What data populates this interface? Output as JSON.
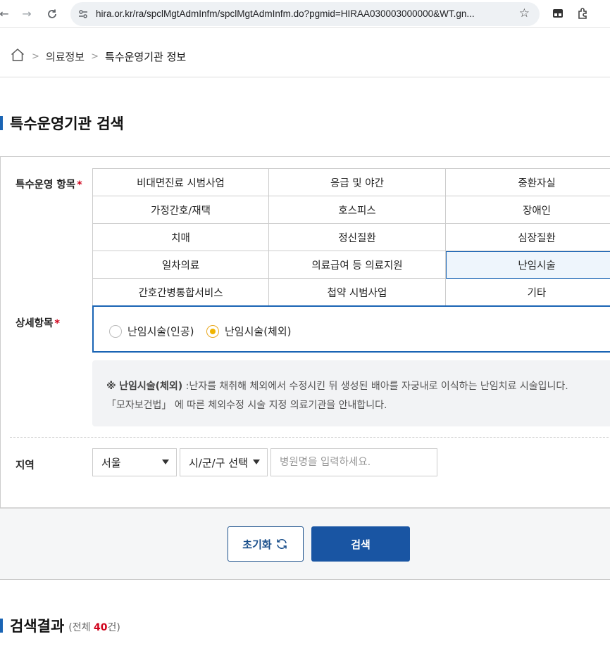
{
  "browser": {
    "url": "hira.or.kr/ra/spclMgtAdmInfm/spclMgtAdmInfm.do?pgmid=HIRAA030003000000&WT.gn..."
  },
  "breadcrumb": {
    "items": [
      "의료정보",
      "특수운영기관 정보"
    ]
  },
  "search_section": {
    "title": "특수운영기관 검색"
  },
  "form": {
    "category_label": "특수운영 항목",
    "required_mark": "*",
    "categories": [
      "비대면진료 시범사업",
      "응급 및 야간",
      "중환자실",
      "가정간호/재택",
      "호스피스",
      "장애인",
      "치매",
      "정신질환",
      "심장질환",
      "일차의료",
      "의료급여 등 의료지원",
      "난임시술",
      "간호간병통합서비스",
      "첩약 시범사업",
      "기타"
    ],
    "selected_category": "난임시술",
    "detail_label": "상세항목",
    "detail_options": [
      "난임시술(인공)",
      "난임시술(체외)"
    ],
    "detail_selected": "난임시술(체외)",
    "note": {
      "prefix": "※",
      "term": "난임시술(체외)",
      "line1": ":난자를 채취해 체외에서 수정시킨 뒤 생성된 배아를 자궁내로 이식하는 난임치료 시술입니다.",
      "line2": "「모자보건법」 에 따른 체외수정 시술 지정 의료기관을 안내합니다."
    },
    "region_label": "지역",
    "region_select": "서울",
    "district_select": "시/군/구 선택",
    "hospital_placeholder": "병원명을 입력하세요.",
    "reset_label": "초기화",
    "search_label": "검색"
  },
  "results": {
    "title": "검색결과",
    "count_prefix": "(전체 ",
    "count": "40",
    "count_suffix": "건)"
  },
  "colors": {
    "accent": "#1a64b4",
    "button_primary": "#1955a3",
    "required": "#d0021b",
    "radio_on": "#f0b400"
  }
}
